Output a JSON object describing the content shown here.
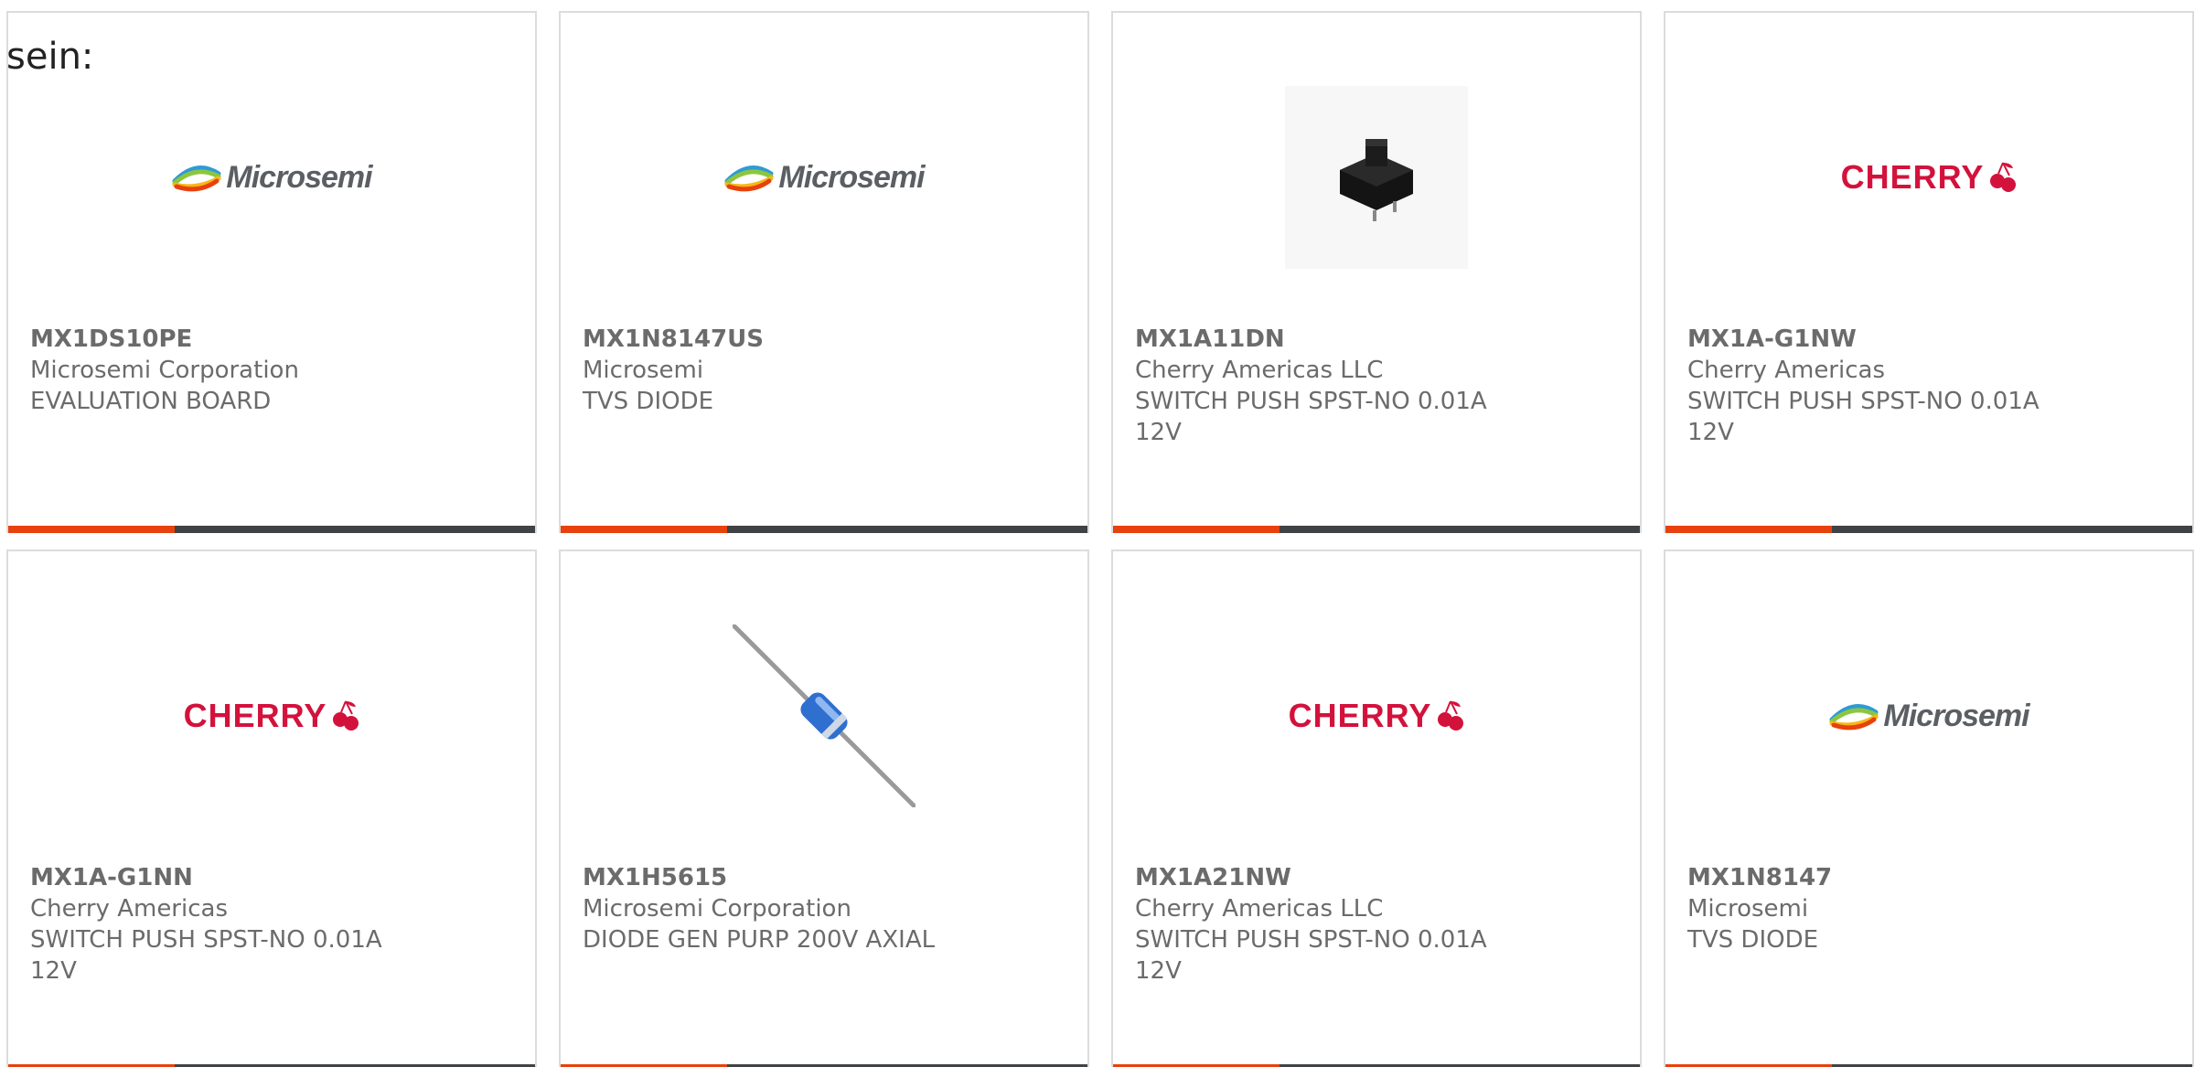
{
  "intro_text": "sein:",
  "colors": {
    "accent_orange": "#e8410d",
    "bar_dark": "#3f4345",
    "text_gray": "#6b6b6b",
    "cherry_red": "#d3123c"
  },
  "products": [
    {
      "image": "microsemi-logo",
      "logo_text": "Microsemi",
      "part_number": "MX1DS10PE",
      "manufacturer": "Microsemi Corporation",
      "description": "EVALUATION BOARD"
    },
    {
      "image": "microsemi-logo",
      "logo_text": "Microsemi",
      "part_number": "MX1N8147US",
      "manufacturer": "Microsemi",
      "description": "TVS DIODE"
    },
    {
      "image": "keyswitch-photo",
      "logo_text": "",
      "part_number": "MX1A11DN",
      "manufacturer": "Cherry Americas LLC",
      "description": "SWITCH PUSH SPST-NO 0.01A 12V"
    },
    {
      "image": "cherry-logo",
      "logo_text": "CHERRY",
      "part_number": "MX1A-G1NW",
      "manufacturer": "Cherry Americas",
      "description": "SWITCH PUSH SPST-NO 0.01A 12V"
    },
    {
      "image": "cherry-logo",
      "logo_text": "CHERRY",
      "part_number": "MX1A-G1NN",
      "manufacturer": "Cherry Americas",
      "description": "SWITCH PUSH SPST-NO 0.01A 12V"
    },
    {
      "image": "diode-photo",
      "logo_text": "",
      "part_number": "MX1H5615",
      "manufacturer": "Microsemi Corporation",
      "description": "DIODE GEN PURP 200V AXIAL"
    },
    {
      "image": "cherry-logo",
      "logo_text": "CHERRY",
      "part_number": "MX1A21NW",
      "manufacturer": "Cherry Americas LLC",
      "description": "SWITCH PUSH SPST-NO 0.01A 12V"
    },
    {
      "image": "microsemi-logo",
      "logo_text": "Microsemi",
      "part_number": "MX1N8147",
      "manufacturer": "Microsemi",
      "description": "TVS DIODE"
    }
  ]
}
